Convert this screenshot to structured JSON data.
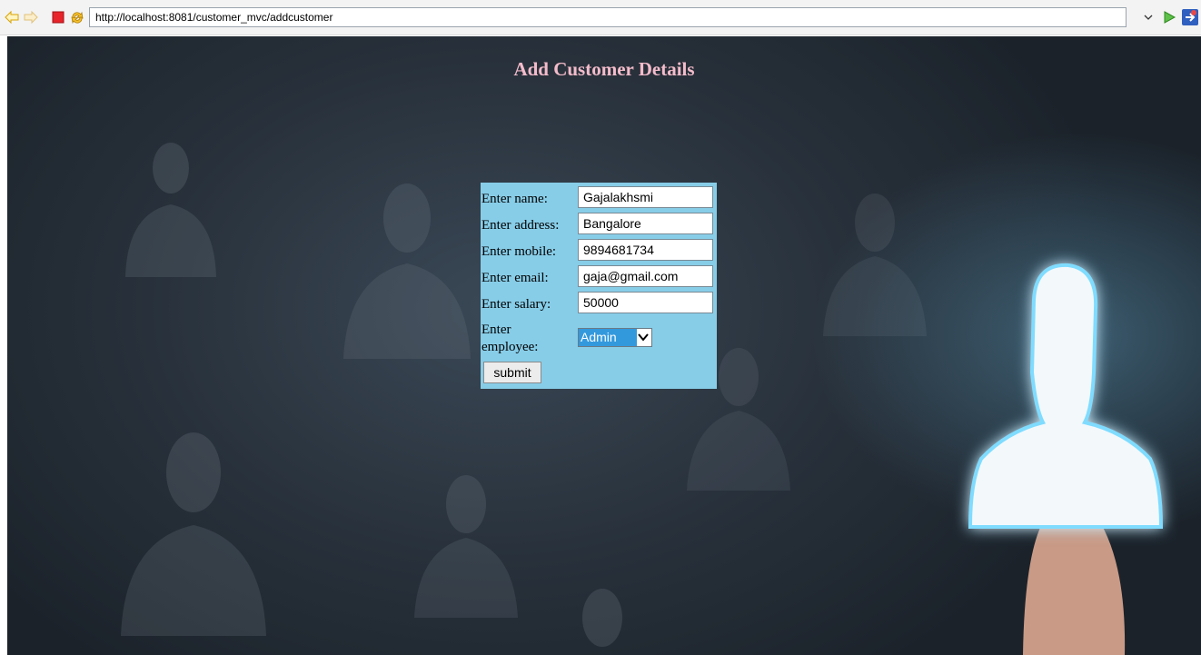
{
  "browser": {
    "url": "http://localhost:8081/customer_mvc/addcustomer"
  },
  "page": {
    "title": "Add Customer Details"
  },
  "form": {
    "name_label": "Enter name:",
    "name_value": "Gajalakhsmi",
    "address_label": "Enter address:",
    "address_value": "Bangalore",
    "mobile_label": "Enter mobile:",
    "mobile_value": "9894681734",
    "email_label": "Enter email:",
    "email_value": "gaja@gmail.com",
    "salary_label": "Enter salary:",
    "salary_value": "50000",
    "employee_label_line1": "Enter",
    "employee_label_line2": "employee:",
    "employee_selected": "Admin",
    "submit_label": "submit"
  },
  "colors": {
    "title": "#f4bccb",
    "form_background": "#87cde8",
    "select_highlight": "#3399dd"
  },
  "icons": [
    "back-arrow-icon",
    "forward-arrow-icon",
    "stop-icon",
    "refresh-icon",
    "url-dropdown-icon",
    "go-icon",
    "external-browser-icon"
  ]
}
